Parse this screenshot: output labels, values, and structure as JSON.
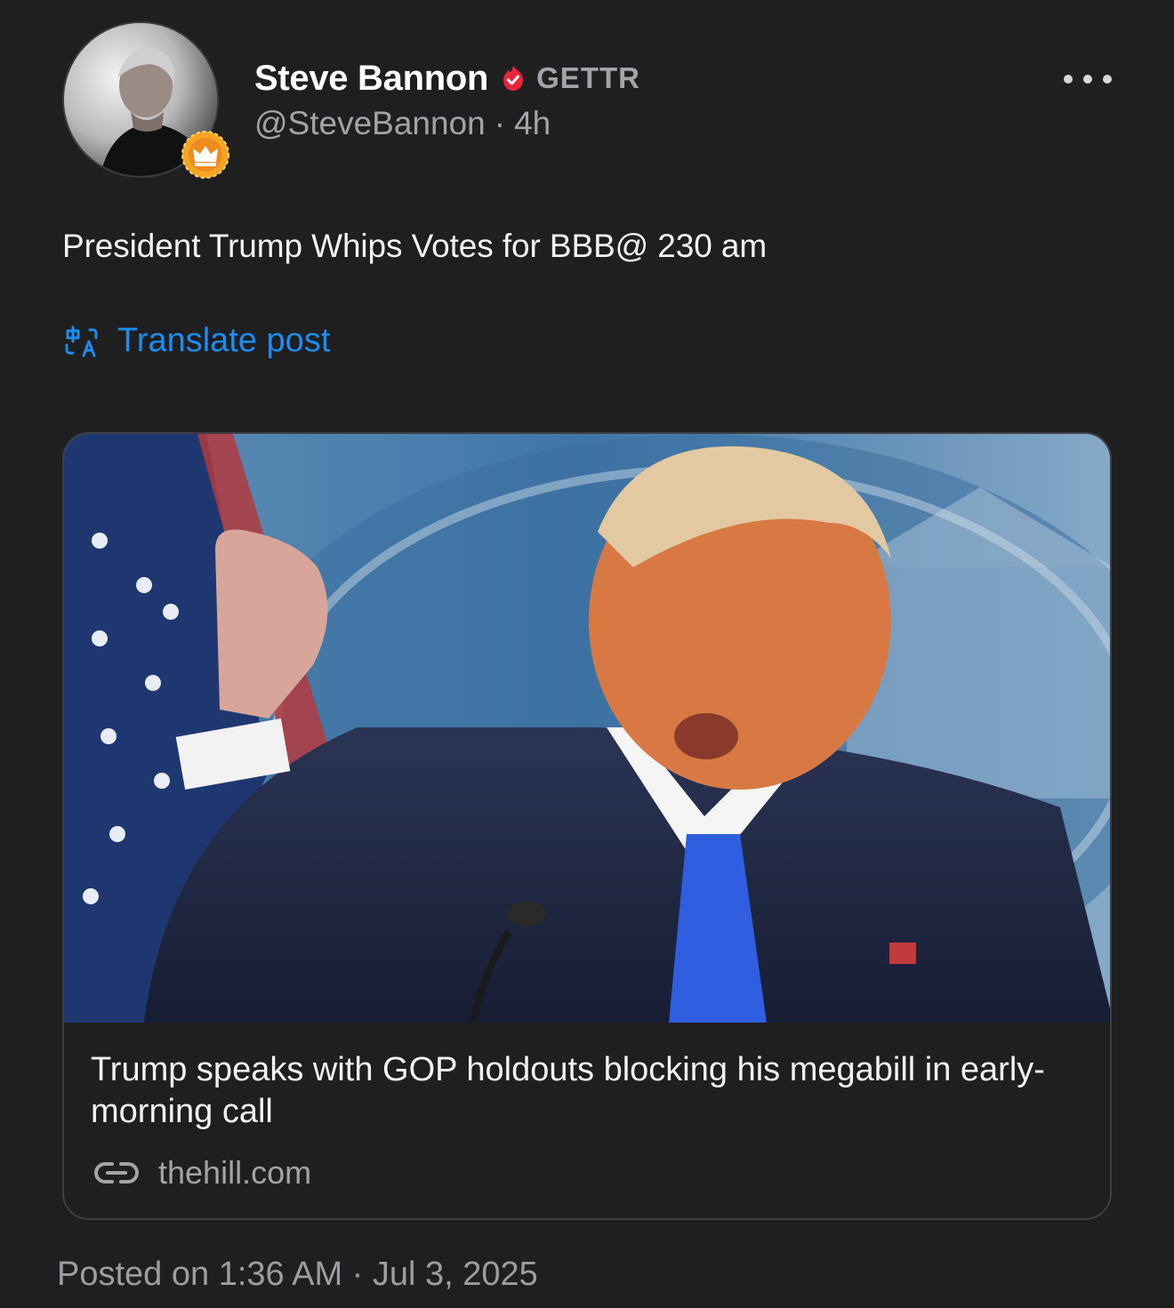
{
  "author": {
    "name": "Steve Bannon",
    "platform": "GETTR",
    "handle": "@SteveBannon",
    "separator": "·",
    "age": "4h",
    "avatar_icon": "avatar-photo",
    "badge_icon": "crown-icon",
    "verified_icon": "verified-icon"
  },
  "post": {
    "text": "President Trump Whips Votes for BBB@ 230 am",
    "translate_label": "Translate post",
    "more_icon": "more-dots-icon"
  },
  "link_card": {
    "title": "Trump speaks with GOP holdouts blocking his megabill in early-morning call",
    "domain": "thehill.com",
    "image_icon": "news-photo",
    "link_icon": "link-icon"
  },
  "footer": {
    "posted": "Posted on 1:36 AM · Jul 3, 2025"
  },
  "colors": {
    "background": "#1f1f20",
    "accent": "#1d8cf2",
    "verified": "#e8253b",
    "secondary_text": "#a3a3a8",
    "badge": "#f5a623"
  }
}
